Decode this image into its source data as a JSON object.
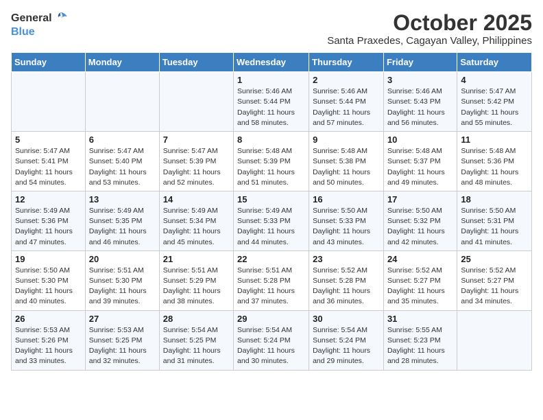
{
  "logo": {
    "line1": "General",
    "line2": "Blue"
  },
  "title": "October 2025",
  "subtitle": "Santa Praxedes, Cagayan Valley, Philippines",
  "weekdays": [
    "Sunday",
    "Monday",
    "Tuesday",
    "Wednesday",
    "Thursday",
    "Friday",
    "Saturday"
  ],
  "weeks": [
    [
      null,
      null,
      null,
      {
        "day": "1",
        "sunrise": "5:46 AM",
        "sunset": "5:44 PM",
        "daylight": "11 hours and 58 minutes."
      },
      {
        "day": "2",
        "sunrise": "5:46 AM",
        "sunset": "5:44 PM",
        "daylight": "11 hours and 57 minutes."
      },
      {
        "day": "3",
        "sunrise": "5:46 AM",
        "sunset": "5:43 PM",
        "daylight": "11 hours and 56 minutes."
      },
      {
        "day": "4",
        "sunrise": "5:47 AM",
        "sunset": "5:42 PM",
        "daylight": "11 hours and 55 minutes."
      }
    ],
    [
      {
        "day": "5",
        "sunrise": "5:47 AM",
        "sunset": "5:41 PM",
        "daylight": "11 hours and 54 minutes."
      },
      {
        "day": "6",
        "sunrise": "5:47 AM",
        "sunset": "5:40 PM",
        "daylight": "11 hours and 53 minutes."
      },
      {
        "day": "7",
        "sunrise": "5:47 AM",
        "sunset": "5:39 PM",
        "daylight": "11 hours and 52 minutes."
      },
      {
        "day": "8",
        "sunrise": "5:48 AM",
        "sunset": "5:39 PM",
        "daylight": "11 hours and 51 minutes."
      },
      {
        "day": "9",
        "sunrise": "5:48 AM",
        "sunset": "5:38 PM",
        "daylight": "11 hours and 50 minutes."
      },
      {
        "day": "10",
        "sunrise": "5:48 AM",
        "sunset": "5:37 PM",
        "daylight": "11 hours and 49 minutes."
      },
      {
        "day": "11",
        "sunrise": "5:48 AM",
        "sunset": "5:36 PM",
        "daylight": "11 hours and 48 minutes."
      }
    ],
    [
      {
        "day": "12",
        "sunrise": "5:49 AM",
        "sunset": "5:36 PM",
        "daylight": "11 hours and 47 minutes."
      },
      {
        "day": "13",
        "sunrise": "5:49 AM",
        "sunset": "5:35 PM",
        "daylight": "11 hours and 46 minutes."
      },
      {
        "day": "14",
        "sunrise": "5:49 AM",
        "sunset": "5:34 PM",
        "daylight": "11 hours and 45 minutes."
      },
      {
        "day": "15",
        "sunrise": "5:49 AM",
        "sunset": "5:33 PM",
        "daylight": "11 hours and 44 minutes."
      },
      {
        "day": "16",
        "sunrise": "5:50 AM",
        "sunset": "5:33 PM",
        "daylight": "11 hours and 43 minutes."
      },
      {
        "day": "17",
        "sunrise": "5:50 AM",
        "sunset": "5:32 PM",
        "daylight": "11 hours and 42 minutes."
      },
      {
        "day": "18",
        "sunrise": "5:50 AM",
        "sunset": "5:31 PM",
        "daylight": "11 hours and 41 minutes."
      }
    ],
    [
      {
        "day": "19",
        "sunrise": "5:50 AM",
        "sunset": "5:30 PM",
        "daylight": "11 hours and 40 minutes."
      },
      {
        "day": "20",
        "sunrise": "5:51 AM",
        "sunset": "5:30 PM",
        "daylight": "11 hours and 39 minutes."
      },
      {
        "day": "21",
        "sunrise": "5:51 AM",
        "sunset": "5:29 PM",
        "daylight": "11 hours and 38 minutes."
      },
      {
        "day": "22",
        "sunrise": "5:51 AM",
        "sunset": "5:28 PM",
        "daylight": "11 hours and 37 minutes."
      },
      {
        "day": "23",
        "sunrise": "5:52 AM",
        "sunset": "5:28 PM",
        "daylight": "11 hours and 36 minutes."
      },
      {
        "day": "24",
        "sunrise": "5:52 AM",
        "sunset": "5:27 PM",
        "daylight": "11 hours and 35 minutes."
      },
      {
        "day": "25",
        "sunrise": "5:52 AM",
        "sunset": "5:27 PM",
        "daylight": "11 hours and 34 minutes."
      }
    ],
    [
      {
        "day": "26",
        "sunrise": "5:53 AM",
        "sunset": "5:26 PM",
        "daylight": "11 hours and 33 minutes."
      },
      {
        "day": "27",
        "sunrise": "5:53 AM",
        "sunset": "5:25 PM",
        "daylight": "11 hours and 32 minutes."
      },
      {
        "day": "28",
        "sunrise": "5:54 AM",
        "sunset": "5:25 PM",
        "daylight": "11 hours and 31 minutes."
      },
      {
        "day": "29",
        "sunrise": "5:54 AM",
        "sunset": "5:24 PM",
        "daylight": "11 hours and 30 minutes."
      },
      {
        "day": "30",
        "sunrise": "5:54 AM",
        "sunset": "5:24 PM",
        "daylight": "11 hours and 29 minutes."
      },
      {
        "day": "31",
        "sunrise": "5:55 AM",
        "sunset": "5:23 PM",
        "daylight": "11 hours and 28 minutes."
      },
      null
    ]
  ]
}
